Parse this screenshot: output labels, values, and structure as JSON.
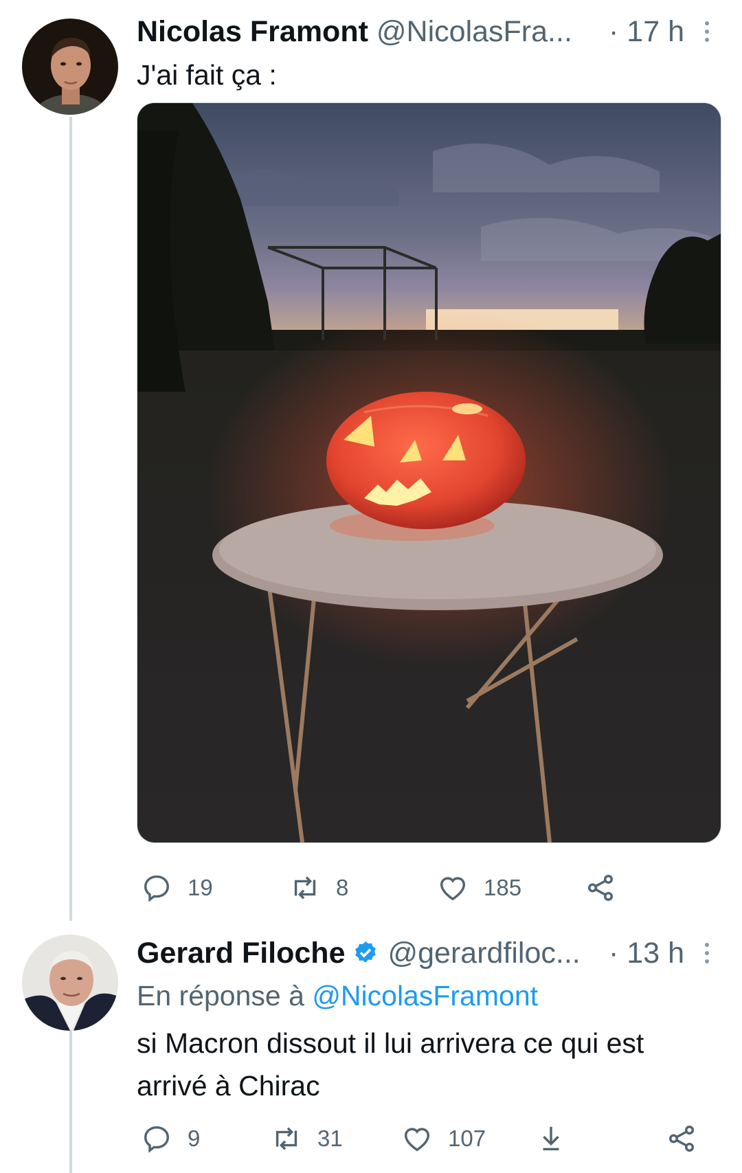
{
  "tweets": [
    {
      "author_name": "Nicolas Framont",
      "handle": "@NicolasFra...",
      "time": "· 17 h",
      "text": "J'ai fait ça :",
      "has_media": true,
      "replies": "19",
      "retweets": "8",
      "likes": "185"
    },
    {
      "author_name": "Gerard Filoche",
      "verified": true,
      "handle": "@gerardfiloc...",
      "time": "· 13 h",
      "reply_prefix": "En réponse à",
      "reply_to": "@NicolasFramont",
      "text_line1": "si Macron dissout il lui arrivera ce qui est",
      "text_line2": "arrivé à Chirac",
      "replies": "9",
      "retweets": "31",
      "likes": "107"
    }
  ],
  "colors": {
    "accent": "#1d9bf0",
    "muted": "#536471",
    "text": "#0f1419"
  },
  "icons": [
    "reply-icon",
    "retweet-icon",
    "like-icon",
    "share-icon",
    "download-icon",
    "more-icon",
    "verified-icon"
  ]
}
